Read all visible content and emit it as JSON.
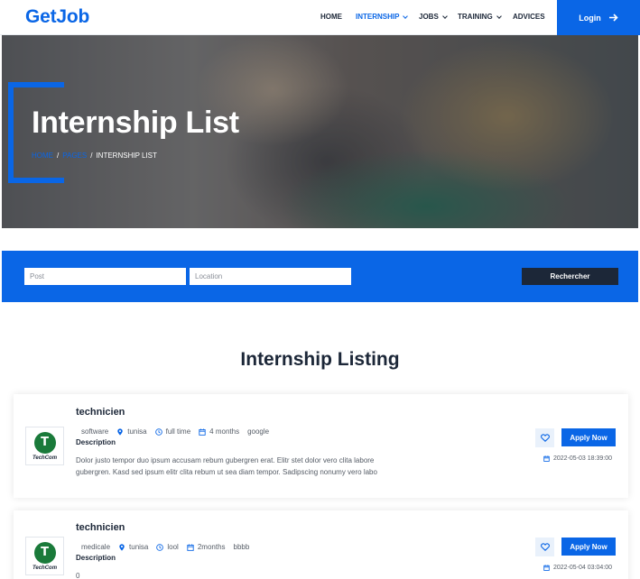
{
  "brand": "GetJob",
  "nav": {
    "home": "HOME",
    "internship": "INTERNSHIP",
    "jobs": "JOBS",
    "training": "TRAINING",
    "advices": "ADVICES",
    "login": "Login"
  },
  "hero": {
    "title": "Internship List",
    "breadcrumb": {
      "home": "HOME",
      "sep1": "/",
      "pages": "PAGES",
      "sep2": "/",
      "current": "INTERNSHIP LIST"
    }
  },
  "search": {
    "post_placeholder": "Post",
    "location_placeholder": "Location",
    "button": "Rechercher"
  },
  "section_title": "Internship Listing",
  "colors": {
    "accent": "#0a66e6",
    "dark": "#1c2738"
  },
  "jobs": [
    {
      "title": "technicien",
      "category": "software",
      "location": "tunisa",
      "type": "full time",
      "duration": "4 months",
      "company": "google",
      "logo_text": "TechCom",
      "description_label": "Description",
      "description_line1": "Dolor justo tempor duo ipsum accusam rebum gubergren erat. Elitr stet dolor vero clita labore",
      "description_line2": "gubergren. Kasd sed ipsum elitr clita rebum ut sea diam tempor. Sadipscing nonumy vero labo",
      "apply_label": "Apply Now",
      "date": "2022-05-03 18:39:00"
    },
    {
      "title": "technicien",
      "category": "medicale",
      "location": "tunisa",
      "type": "lool",
      "duration": "2months",
      "company": "bbbb",
      "logo_text": "TechCom",
      "description_label": "Description",
      "description_line1": "0",
      "apply_label": "Apply Now",
      "date": "2022-05-04 03:04:00"
    }
  ]
}
